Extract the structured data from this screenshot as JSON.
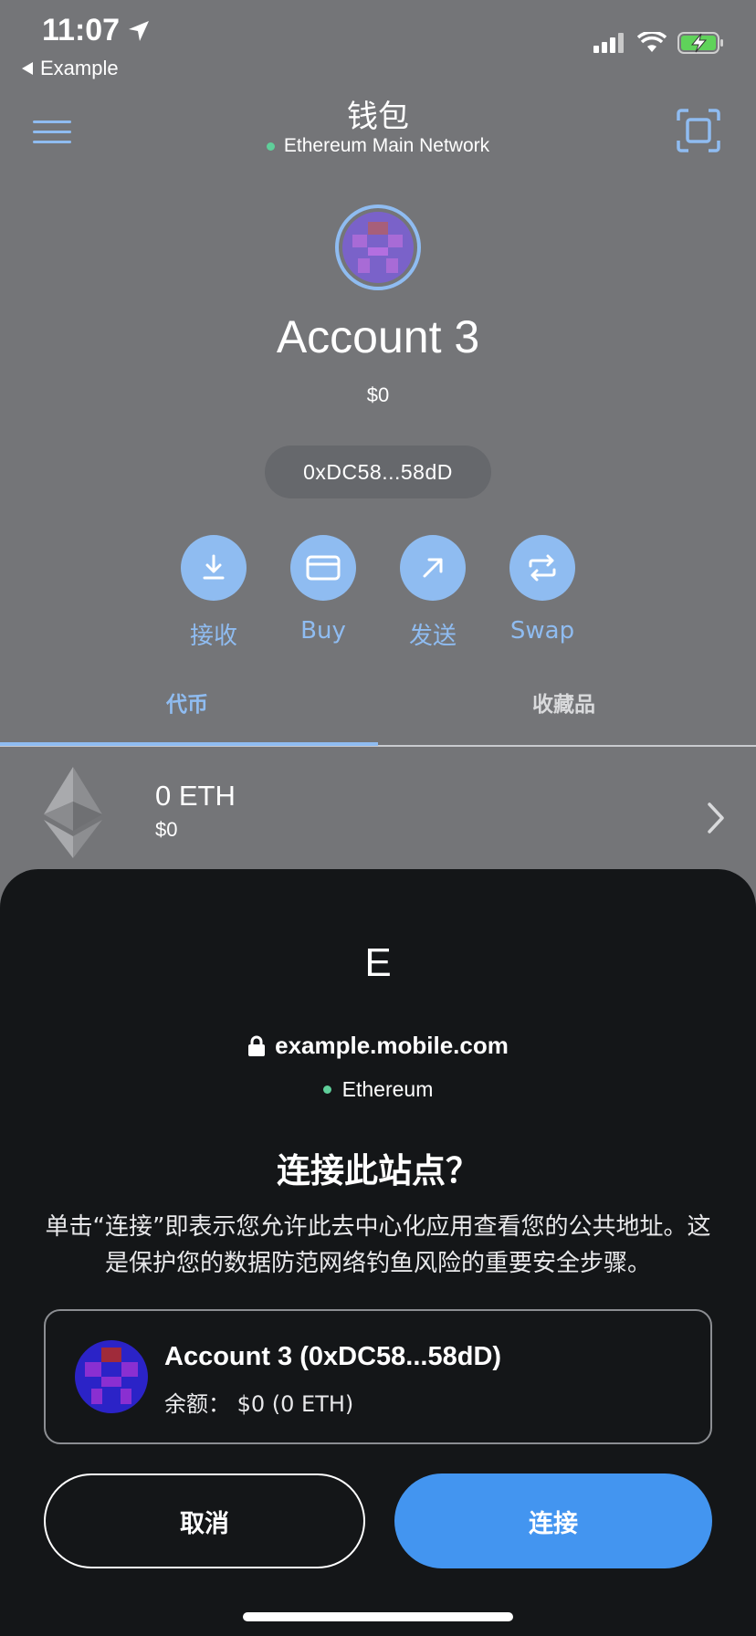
{
  "status_bar": {
    "time": "11:07",
    "back_app": "Example",
    "icons": [
      "location-arrow-icon",
      "cellular-signal-icon",
      "wifi-icon",
      "battery-charging-icon"
    ]
  },
  "header": {
    "title": "钱包",
    "network": "Ethereum Main Network",
    "left_icon": "menu-icon",
    "right_icon": "scan-icon"
  },
  "account": {
    "name": "Account 3",
    "balance": "$0",
    "address_short": "0xDC58...58dD"
  },
  "actions": [
    {
      "label": "接收",
      "icon": "receive-icon"
    },
    {
      "label": "Buy",
      "icon": "card-icon"
    },
    {
      "label": "发送",
      "icon": "send-arrow-icon"
    },
    {
      "label": "Swap",
      "icon": "swap-icon"
    }
  ],
  "tabs": {
    "tokens": "代币",
    "collectibles": "收藏品",
    "active": "tokens"
  },
  "token_row": {
    "amount": "0 ETH",
    "value": "$0",
    "icon": "ethereum-icon"
  },
  "connect_sheet": {
    "site_letter": "E",
    "site_url": "example.mobile.com",
    "site_network": "Ethereum",
    "title": "连接此站点？",
    "description": "单击“连接”即表示您允许此去中心化应用查看您的公共地址。这是保护您的数据防范网络钓鱼风险的重要安全步骤。",
    "account_label": "Account 3 (0xDC58...58dD)",
    "balance_label": "余额：  $0 (0 ETH)",
    "cancel_label": "取消",
    "connect_label": "连接"
  },
  "colors": {
    "background_dim": "#747578",
    "accent": "#8fbcf1",
    "connect_button": "#4395f0",
    "sheet_bg": "#141618",
    "network_dot": "#5fcf9a"
  }
}
